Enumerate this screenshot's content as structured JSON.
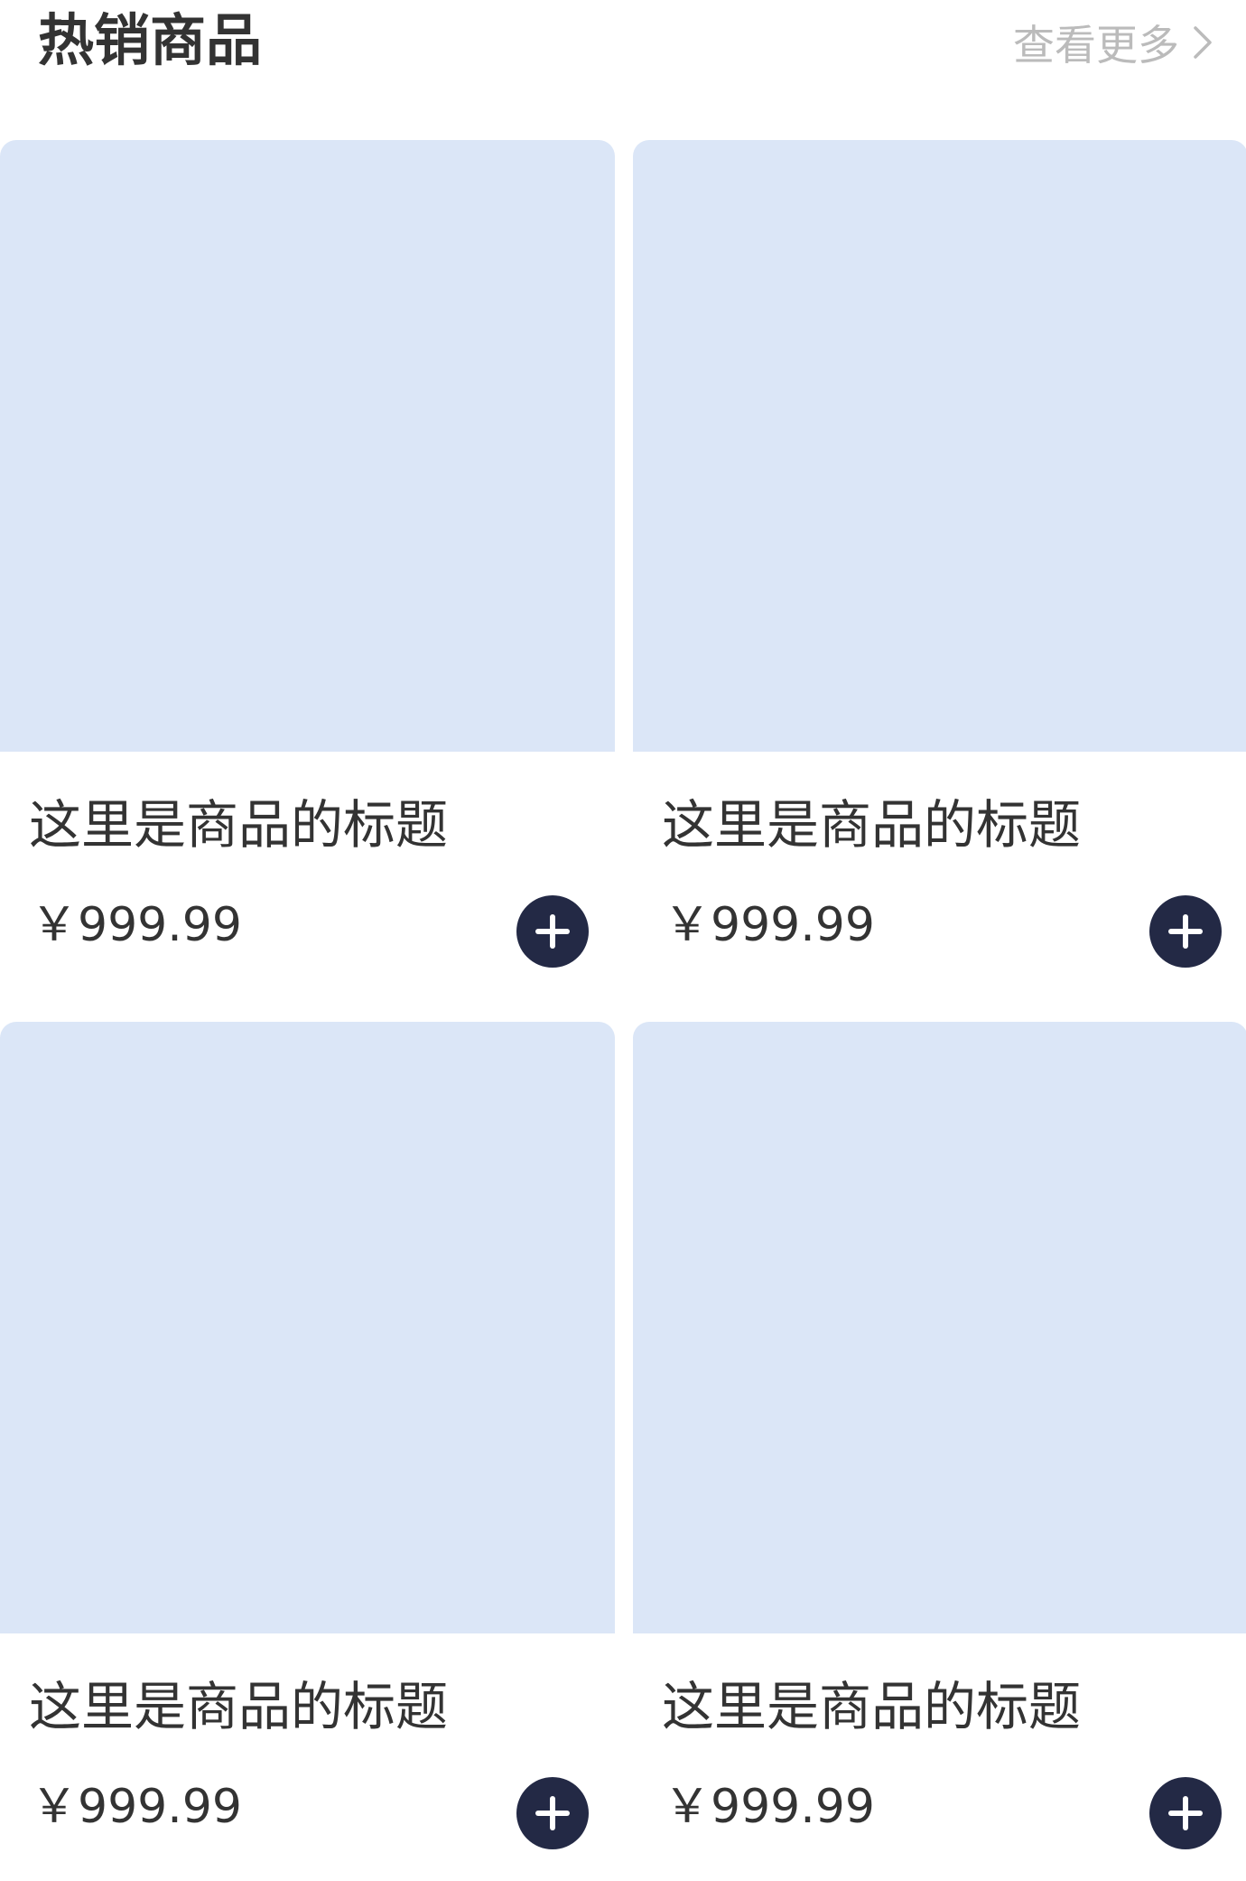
{
  "header": {
    "title": "热销商品",
    "more_label": "查看更多"
  },
  "icons": {
    "more": "chevron-right-icon",
    "add": "plus-icon"
  },
  "colors": {
    "image_placeholder": "#dbe6f7",
    "add_button": "#232945",
    "text": "#333333",
    "more_text": "#bbbbbb"
  },
  "products": [
    {
      "title": "这里是商品的标题",
      "price": "￥999.99"
    },
    {
      "title": "这里是商品的标题",
      "price": "￥999.99"
    },
    {
      "title": "这里是商品的标题",
      "price": "￥999.99"
    },
    {
      "title": "这里是商品的标题",
      "price": "￥999.99"
    }
  ]
}
